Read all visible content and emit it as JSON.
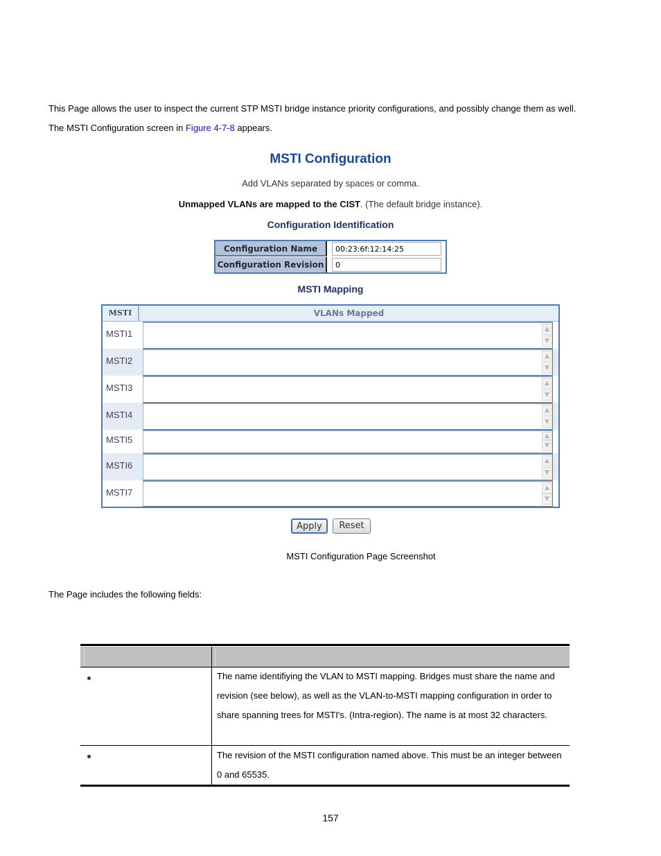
{
  "intro": {
    "line1": "This Page allows the user to inspect the current STP MSTI bridge instance priority configurations, and possibly change them as well.",
    "line2_prefix": "The MSTI Configuration screen in ",
    "line2_link": "Figure 4-7-8",
    "line2_suffix": " appears."
  },
  "screenshot": {
    "title": "MSTI Configuration",
    "note1": "Add VLANs separated by spaces or comma.",
    "note2_bold": "Unmapped VLANs are mapped to the CIST",
    "note2_rest": ". (The default bridge instance).",
    "config_id_heading": "Configuration Identification",
    "config": {
      "name_label": "Configuration Name",
      "name_value": "00:23:6f:12:14:25",
      "revision_label": "Configuration Revision",
      "revision_value": "0"
    },
    "mapping_heading": "MSTI Mapping",
    "mapping": {
      "col_msti": "MSTI",
      "col_vlans": "VLANs Mapped",
      "rows": [
        {
          "msti": "MSTI1",
          "vlans": ""
        },
        {
          "msti": "MSTI2",
          "vlans": ""
        },
        {
          "msti": "MSTI3",
          "vlans": ""
        },
        {
          "msti": "MSTI4",
          "vlans": ""
        },
        {
          "msti": "MSTI5",
          "vlans": ""
        },
        {
          "msti": "MSTI6",
          "vlans": ""
        },
        {
          "msti": "MSTI7",
          "vlans": ""
        }
      ]
    },
    "buttons": {
      "apply": "Apply",
      "reset": "Reset"
    },
    "scroll_up_icon": "▲",
    "scroll_down_icon": "▼"
  },
  "caption": "MSTI Configuration Page Screenshot",
  "fields_intro": "The Page includes the following fields:",
  "fields_table": {
    "header": [
      "",
      ""
    ],
    "rows": [
      {
        "object": "",
        "description": "The name identifiying the VLAN to MSTI mapping. Bridges must share the name and revision (see below), as well as the VLAN-to-MSTI mapping configuration in order to share spanning trees for MSTI's. (Intra-region). The name is at most 32 characters."
      },
      {
        "object": "",
        "description": "The revision of the MSTI configuration named above. This must be an integer between 0 and 65535."
      }
    ]
  },
  "page_number": "157"
}
